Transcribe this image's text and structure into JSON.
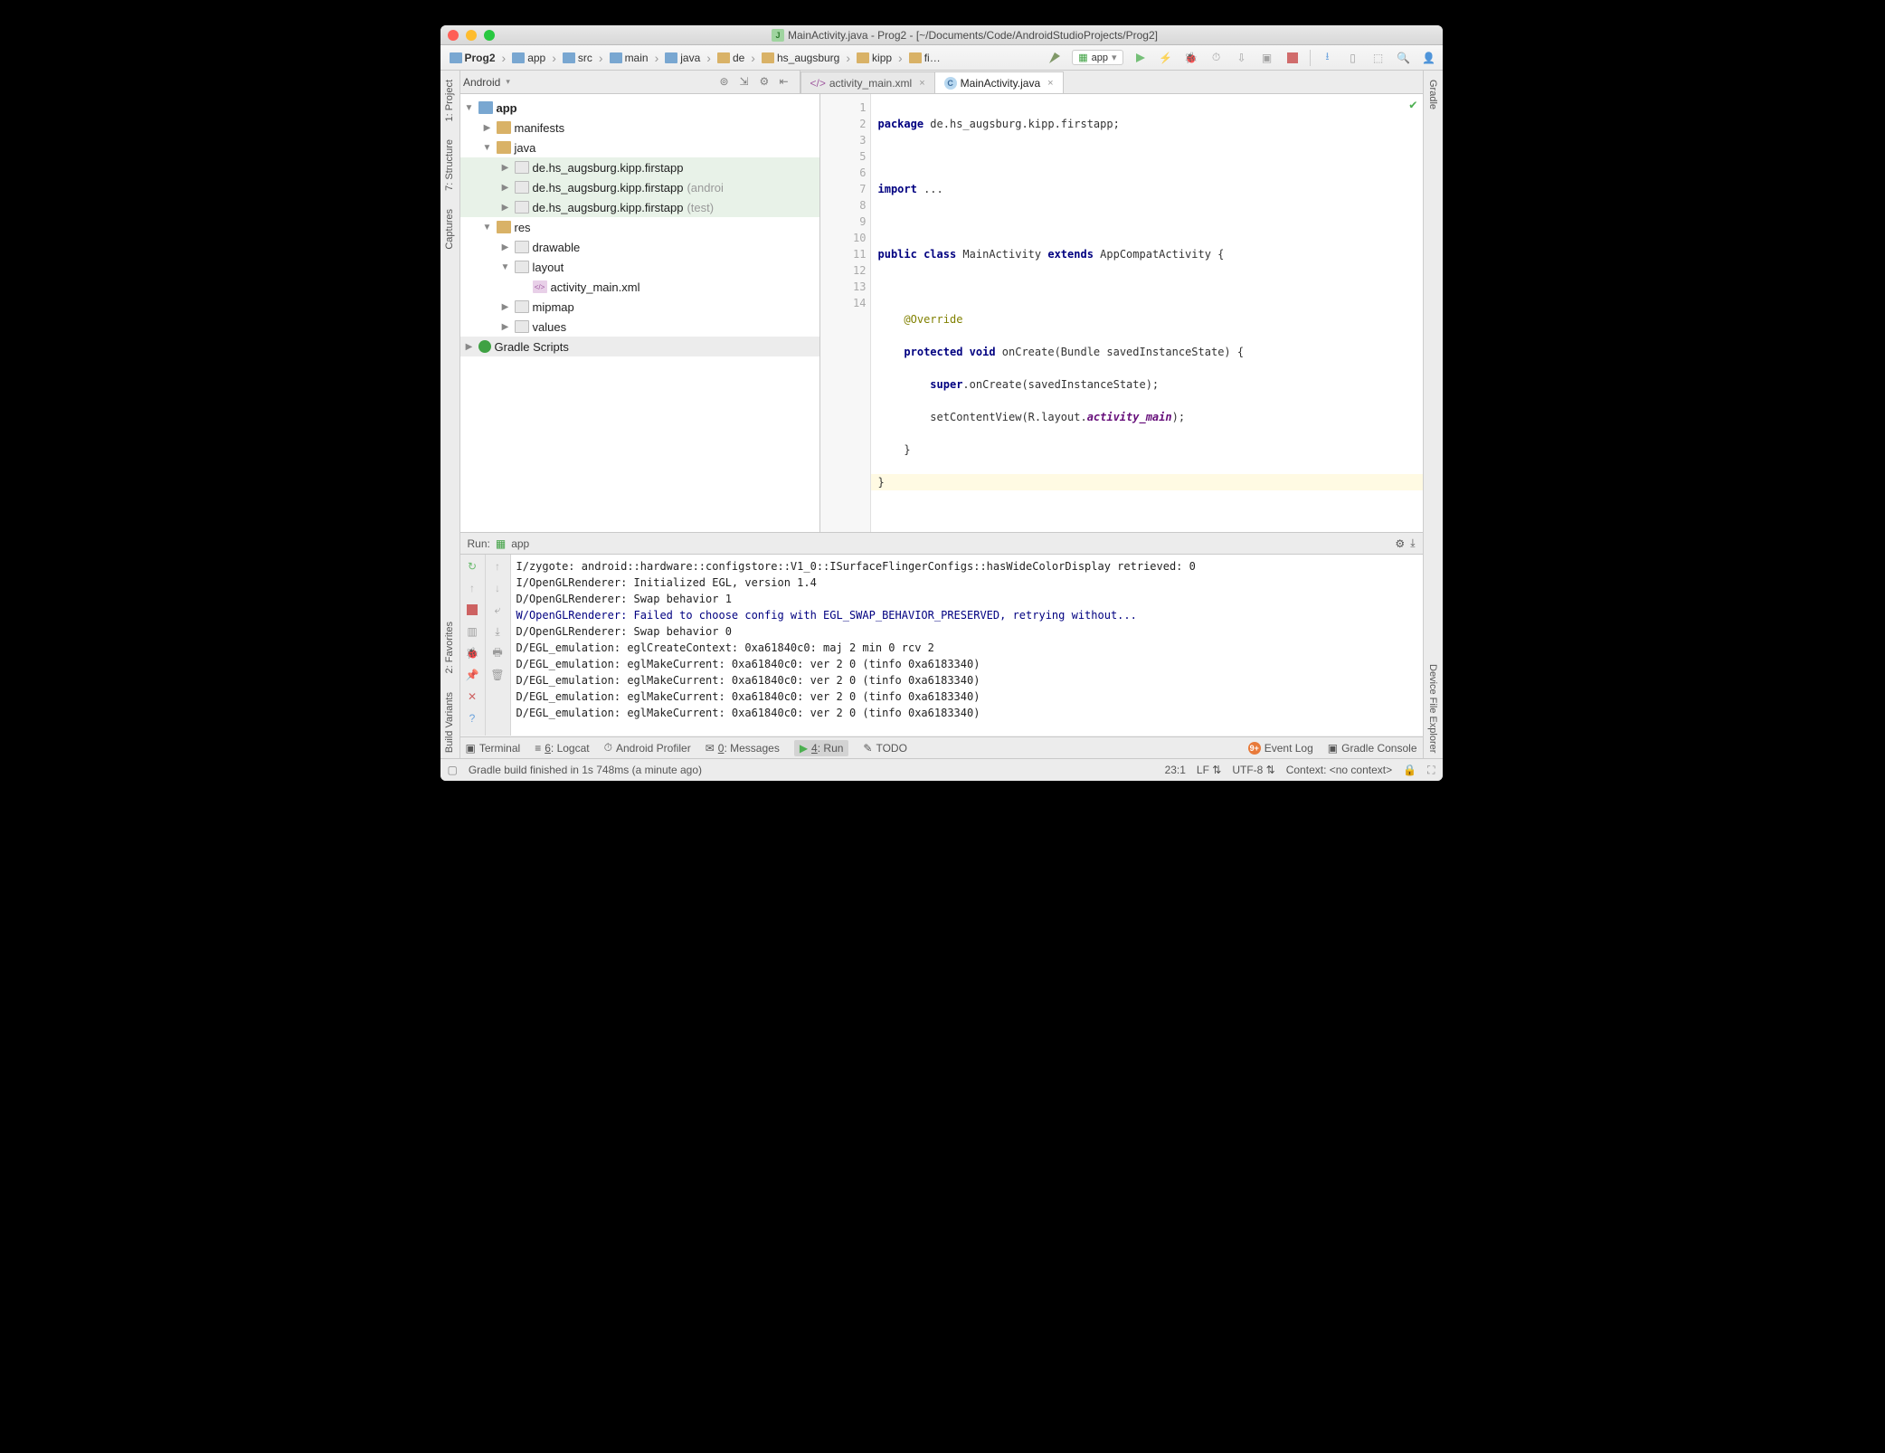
{
  "title": "MainActivity.java - Prog2 - [~/Documents/Code/AndroidStudioProjects/Prog2]",
  "breadcrumb": [
    "Prog2",
    "app",
    "src",
    "main",
    "java",
    "de",
    "hs_augsburg",
    "kipp",
    "fi…"
  ],
  "runTarget": "app",
  "projHeader": {
    "view": "Android"
  },
  "tabs": [
    {
      "label": "activity_main.xml",
      "active": false
    },
    {
      "label": "MainActivity.java",
      "active": true
    }
  ],
  "tree": {
    "app": "app",
    "manifests": "manifests",
    "java": "java",
    "pkg": "de.hs_augsburg.kipp.firstapp",
    "pkgAndroid": "de.hs_augsburg.kipp.firstapp",
    "pkgAndroidQual": "(androi",
    "pkgTest": "de.hs_augsburg.kipp.firstapp",
    "pkgTestQual": "(test)",
    "res": "res",
    "drawable": "drawable",
    "layout": "layout",
    "activityXml": "activity_main.xml",
    "mipmap": "mipmap",
    "values": "values",
    "gradle": "Gradle Scripts"
  },
  "code": {
    "lines": [
      "1",
      "2",
      "3",
      "5",
      "6",
      "7",
      "8",
      "9",
      "10",
      "11",
      "12",
      "13",
      "14"
    ],
    "pkg": "package ",
    "pkgName": "de.hs_augsburg.kipp.firstapp;",
    "imp": "import ",
    "impDots": "...",
    "pub": "public class ",
    "cls": "MainActivity ",
    "ext": "extends ",
    "sup": "AppCompatActivity {",
    "ovr": "@Override",
    "prot": "protected void ",
    "meth": "onCreate(Bundle savedInstanceState) {",
    "superc": "super",
    "supercall": ".onCreate(savedInstanceState);",
    "scv": "setContentView(R.layout.",
    "am": "activity_main",
    "scv2": ");",
    "cb1": "}",
    "cb2": "}"
  },
  "run": {
    "title": "Run:",
    "target": "app",
    "lines": [
      "I/zygote: android::hardware::configstore::V1_0::ISurfaceFlingerConfigs::hasWideColorDisplay retrieved: 0",
      "I/OpenGLRenderer: Initialized EGL, version 1.4",
      "D/OpenGLRenderer: Swap behavior 1",
      "W/OpenGLRenderer: Failed to choose config with EGL_SWAP_BEHAVIOR_PRESERVED, retrying without...",
      "D/OpenGLRenderer: Swap behavior 0",
      "D/EGL_emulation: eglCreateContext: 0xa61840c0: maj 2 min 0 rcv 2",
      "D/EGL_emulation: eglMakeCurrent: 0xa61840c0: ver 2 0 (tinfo 0xa6183340)",
      "D/EGL_emulation: eglMakeCurrent: 0xa61840c0: ver 2 0 (tinfo 0xa6183340)",
      "D/EGL_emulation: eglMakeCurrent: 0xa61840c0: ver 2 0 (tinfo 0xa6183340)",
      "D/EGL_emulation: eglMakeCurrent: 0xa61840c0: ver 2 0 (tinfo 0xa6183340)"
    ]
  },
  "bottomTabs": {
    "terminal": "Terminal",
    "logcat": "6: Logcat",
    "profiler": "Android Profiler",
    "messages": "0: Messages",
    "run": "4: Run",
    "todo": "TODO",
    "eventlog": "Event Log",
    "gradleConsole": "Gradle Console"
  },
  "leftTabs": {
    "project": "1: Project",
    "structure": "7: Structure",
    "captures": "Captures",
    "favorites": "2: Favorites",
    "buildVariants": "Build Variants"
  },
  "rightTabs": {
    "gradle": "Gradle",
    "deviceExplorer": "Device File Explorer"
  },
  "status": {
    "msg": "Gradle build finished in 1s 748ms (a minute ago)",
    "pos": "23:1",
    "le": "LF",
    "enc": "UTF-8",
    "ctx": "Context: <no context>"
  }
}
